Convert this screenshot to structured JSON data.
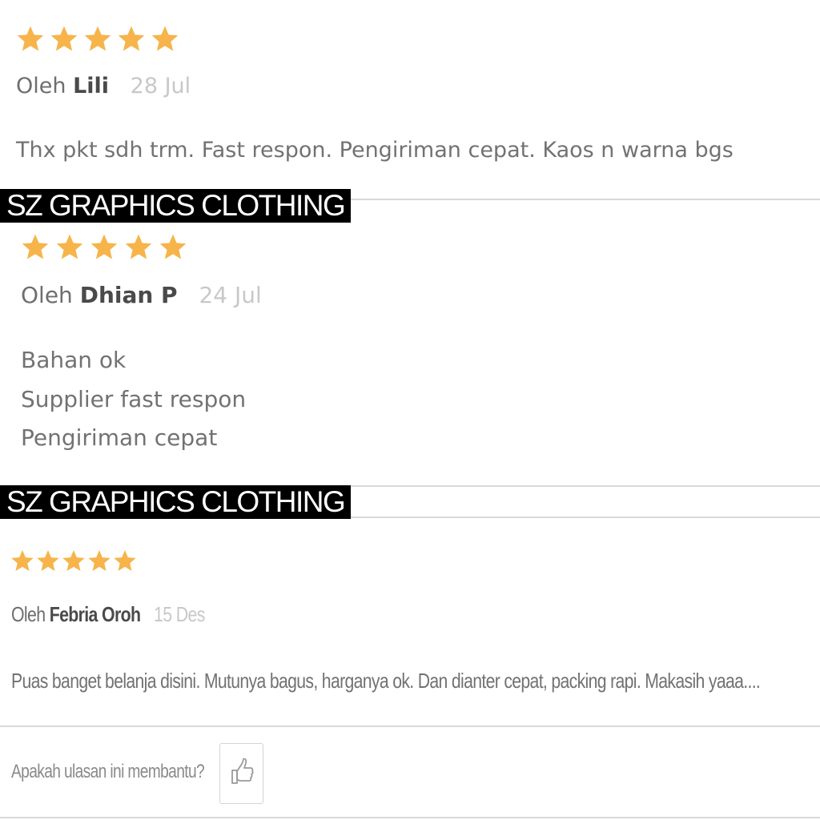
{
  "colors": {
    "star": "#F6B44B",
    "banner_bg": "#000000",
    "banner_text": "#FFFFFF",
    "rule": "#D9D9D9"
  },
  "banner_text": "SZ GRAPHICS CLOTHING",
  "reviews": [
    {
      "rating": 5,
      "prefix": "Oleh",
      "name": "Lili",
      "date": "28 Jul",
      "lines": [
        "Thx pkt sdh trm. Fast respon. Pengiriman cepat. Kaos n warna bgs"
      ]
    },
    {
      "rating": 5,
      "prefix": "Oleh",
      "name": "Dhian P",
      "date": "24 Jul",
      "lines": [
        "Bahan ok",
        "Supplier fast respon",
        "Pengiriman cepat"
      ]
    },
    {
      "rating": 5,
      "prefix": "Oleh",
      "name": "Febria Oroh",
      "date": "15 Des",
      "lines": [
        "Puas banget belanja disini. Mutunya bagus, harganya ok. Dan dianter cepat, packing rapi. Makasih yaaa...."
      ]
    }
  ],
  "helpful": {
    "question": "Apakah ulasan ini membantu?",
    "icon": "thumbs-up-icon"
  }
}
